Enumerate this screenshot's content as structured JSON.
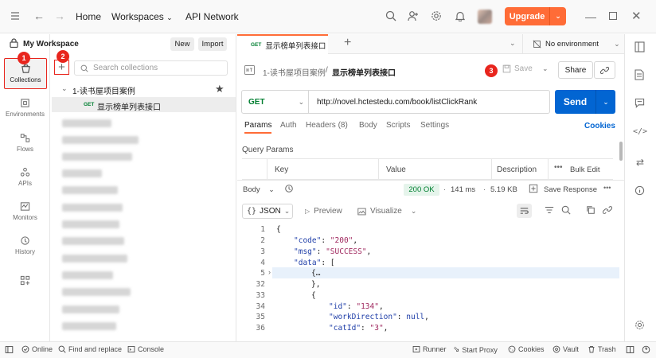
{
  "topbar": {
    "home": "Home",
    "workspaces": "Workspaces",
    "api_network": "API Network",
    "upgrade": "Upgrade"
  },
  "workspace": {
    "name": "My Workspace",
    "new_btn": "New",
    "import_btn": "Import",
    "search_placeholder": "Search collections"
  },
  "sidebar_nav": {
    "collections": "Collections",
    "environments": "Environments",
    "flows": "Flows",
    "apis": "APIs",
    "monitors": "Monitors",
    "history": "History"
  },
  "badges": {
    "b1": "1",
    "b2": "2",
    "b3": "3"
  },
  "tree": {
    "collection": "1-读书屋项目案例",
    "request_method": "GET",
    "request_name": "显示榜单列表接口"
  },
  "tab": {
    "method": "GET",
    "name": "显示榜单列表接口",
    "env": "No environment"
  },
  "breadcrumb": {
    "parent": "1-读书屋项目案例",
    "sep": "/",
    "current": "显示榜单列表接口"
  },
  "actions": {
    "save": "Save",
    "share": "Share"
  },
  "request": {
    "method": "GET",
    "url": "http://novel.hctestedu.com/book/listClickRank",
    "send": "Send"
  },
  "req_tabs": {
    "params": "Params",
    "auth": "Auth",
    "headers": "Headers (8)",
    "body": "Body",
    "scripts": "Scripts",
    "settings": "Settings",
    "cookies": "Cookies"
  },
  "query_params": {
    "title": "Query Params",
    "col_key": "Key",
    "col_value": "Value",
    "col_description": "Description",
    "bulk_edit": "Bulk Edit"
  },
  "response": {
    "body_label": "Body",
    "status": "200 OK",
    "sep1": "·",
    "time": "141 ms",
    "sep2": "·",
    "size": "5.19 KB",
    "save_response": "Save Response",
    "format": "JSON",
    "preview": "Preview",
    "visualize": "Visualize"
  },
  "code_lines": {
    "n1": "1",
    "n2": "2",
    "n3": "3",
    "n4": "4",
    "n5": "5",
    "n32": "32",
    "n33": "33",
    "n34": "34",
    "n35": "35",
    "n36": "36",
    "l1": "{",
    "l2k": "\"code\"",
    "l2v": "\"200\"",
    "l3k": "\"msg\"",
    "l3v": "\"SUCCESS\"",
    "l4k": "\"data\"",
    "l4v": "[",
    "l5": "{…",
    "l32": "},",
    "l33": "{",
    "l34k": "\"id\"",
    "l34v": "\"134\"",
    "l35k": "\"workDirection\"",
    "l35v": "null",
    "l36k": "\"catId\"",
    "l36v": "\"3\""
  },
  "statusbar": {
    "online": "Online",
    "find_replace": "Find and replace",
    "console": "Console",
    "runner": "Runner",
    "start_proxy": "Start Proxy",
    "cookies": "Cookies",
    "vault": "Vault",
    "trash": "Trash"
  },
  "colors": {
    "accent": "#ff6c37",
    "send": "#0265d2",
    "ok": "#007f31",
    "badge": "#e8251d"
  }
}
